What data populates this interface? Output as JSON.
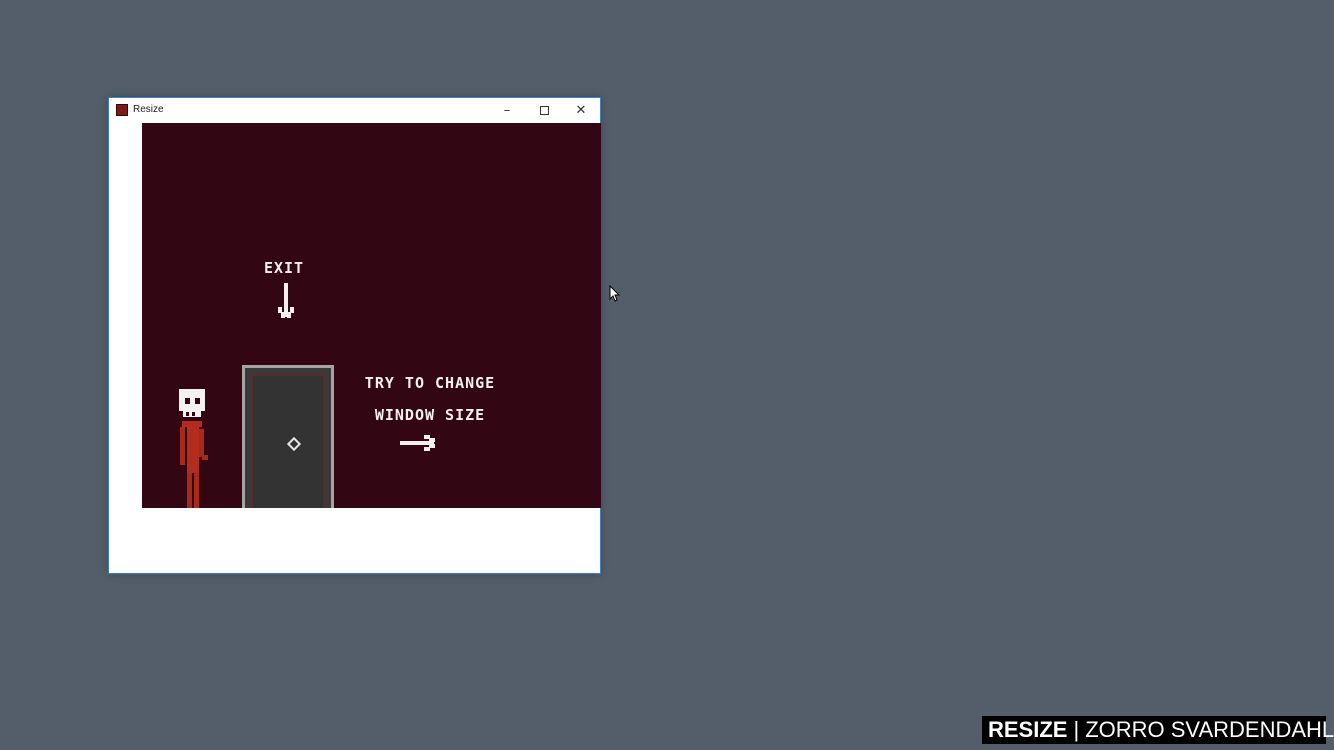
{
  "window": {
    "title": "Resize",
    "minimize_glyph": "–",
    "close_glyph": "✕"
  },
  "game": {
    "exit_label": "EXIT",
    "hint_line1": "TRY TO CHANGE",
    "hint_line2": "WINDOW SIZE",
    "background_color": "#330614",
    "icons": [
      "skeleton-icon",
      "door-icon",
      "arrow-down-icon",
      "arrow-right-icon"
    ]
  },
  "watermark": {
    "title": "RESIZE",
    "separator": "|",
    "author": "ZORRO SVARDENDAHL"
  }
}
